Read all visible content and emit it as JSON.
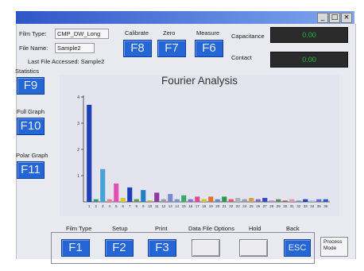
{
  "window": {
    "controls": [
      "_",
      "□",
      "×"
    ]
  },
  "info": {
    "film_type_label": "Film Type:",
    "film_type_value": "CMP_DW_Long",
    "file_name_label": "File Name:",
    "file_name_value": "Sample2",
    "last_file": "Last File Accessed: Sample2"
  },
  "top_actions": [
    {
      "label": "Calibrate",
      "key": "F8"
    },
    {
      "label": "Zero",
      "key": "F7"
    },
    {
      "label": "Measure",
      "key": "F6"
    }
  ],
  "readouts": {
    "capacitance_label": "Capacitance",
    "capacitance_value": "0.00",
    "contact_label": "Contact",
    "contact_value": "0.00",
    "value_color": "#1fb83a"
  },
  "side_actions": [
    {
      "label": "Statistics",
      "key": "F9"
    },
    {
      "label": "Full Graph",
      "key": "F10"
    },
    {
      "label": "Polar Graph",
      "key": "F11"
    }
  ],
  "bottom_actions": [
    {
      "label": "Film Type",
      "key": "F1"
    },
    {
      "label": "Setup",
      "key": "F2"
    },
    {
      "label": "Print",
      "key": "F3"
    },
    {
      "label": "Data File Options",
      "key": ""
    },
    {
      "label": "Hold",
      "key": ""
    },
    {
      "label": "Back",
      "key": "ESC"
    }
  ],
  "process_mode": {
    "line1": "Process",
    "line2": "Mode"
  },
  "colors": {
    "fkey": "#2566d6",
    "titlebar": "#2f56c8"
  },
  "chart_data": {
    "type": "bar",
    "title": "Fourier Analysis",
    "xlabel": "",
    "ylabel": "",
    "ylim": [
      0,
      4
    ],
    "yticks": [
      1,
      2,
      3,
      4
    ],
    "categories": [
      "1",
      "2",
      "3",
      "4",
      "5",
      "6",
      "7",
      "8",
      "9",
      "10",
      "11",
      "12",
      "13",
      "14",
      "15",
      "16",
      "17",
      "18",
      "19",
      "20",
      "21",
      "22",
      "23",
      "24",
      "25",
      "26",
      "27",
      "28",
      "29",
      "30",
      "31",
      "32",
      "33",
      "34",
      "35",
      "36"
    ],
    "values": [
      3.7,
      0.1,
      1.25,
      0.1,
      0.7,
      0.15,
      0.55,
      0.1,
      0.45,
      0.05,
      0.35,
      0.1,
      0.3,
      0.1,
      0.25,
      0.1,
      0.2,
      0.1,
      0.2,
      0.1,
      0.2,
      0.1,
      0.15,
      0.1,
      0.15,
      0.1,
      0.15,
      0.05,
      0.1,
      0.05,
      0.1,
      0.05,
      0.1,
      0.05,
      0.1,
      0.1
    ],
    "bar_colors": [
      "#1f3fb8",
      "#2e9c6a",
      "#46a3d6",
      "#f07a8a",
      "#e84fb4",
      "#d7c62c",
      "#1f3fb8",
      "#4f9c4a",
      "#1f7fc8",
      "#b9a93c",
      "#8a3aa0",
      "#9a9aa4",
      "#7a8ad0",
      "#6a9ad6",
      "#3aa86a",
      "#8a6ad0",
      "#e04a8a",
      "#d0c02c",
      "#e07030",
      "#5a8ad0",
      "#2a9a4a",
      "#e05a5a",
      "#b0b0b8",
      "#9a9aa4",
      "#d0a040",
      "#7a6ad0",
      "#2a4ab8",
      "#c07ad0",
      "#5a8a5a",
      "#a05a5a",
      "#e090b0",
      "#7090d0",
      "#1f3fb8",
      "#90c0e0",
      "#5a6ad0",
      "#1f5fc8"
    ]
  }
}
